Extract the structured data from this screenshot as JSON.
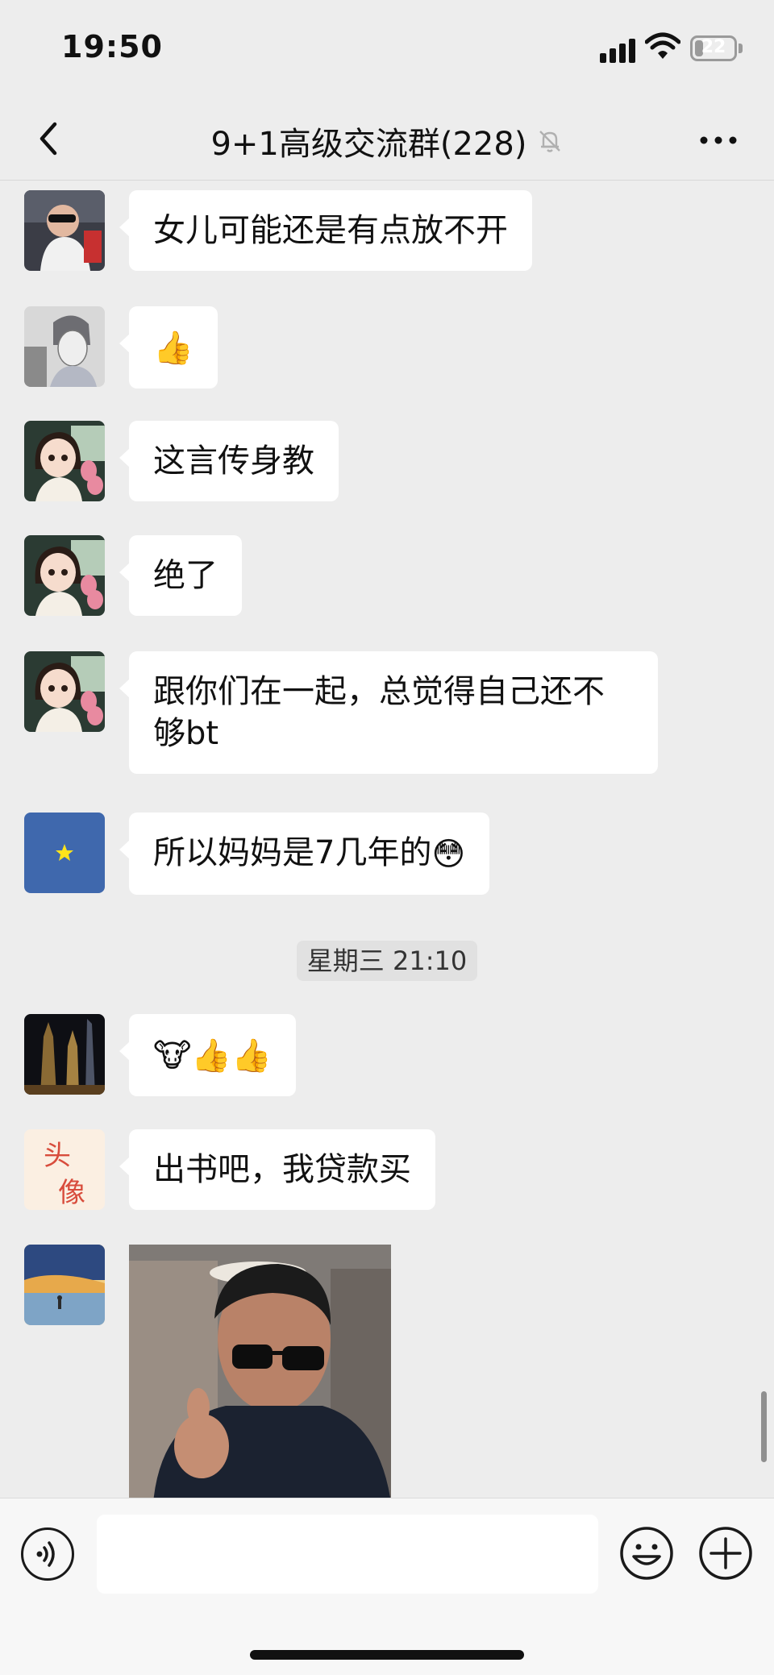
{
  "status_bar": {
    "time": "19:50",
    "battery": "22",
    "battery_level": 0.22
  },
  "header": {
    "title": "9+1高级交流群(228)",
    "back_icon": "chevron-left-icon",
    "mute_icon": "bell-slash-icon",
    "more_icon": "ellipsis-icon"
  },
  "messages": [
    {
      "type": "text",
      "avatar": "baby-photo",
      "text": "女儿可能还是有点放不开"
    },
    {
      "type": "emoji",
      "avatar": "anime-boy",
      "emoji": "👍"
    },
    {
      "type": "text",
      "avatar": "cartoon-girl",
      "text": "这言传身教"
    },
    {
      "type": "text",
      "avatar": "cartoon-girl",
      "text": "绝了"
    },
    {
      "type": "text",
      "avatar": "cartoon-girl",
      "text_line1": "跟你们在一起，总觉得自己还不",
      "text_line2": "够bt"
    },
    {
      "type": "text",
      "avatar": "blue-star",
      "text": "所以妈妈是7几年的",
      "emoji": "😳"
    },
    {
      "type": "time",
      "text": "星期三 21:10"
    },
    {
      "type": "emoji",
      "avatar": "city-night",
      "emoji": "🐮👍👍"
    },
    {
      "type": "text",
      "avatar": "calligraphy",
      "text": "出书吧，我贷款买",
      "avatar_text": "头像"
    },
    {
      "type": "sticker",
      "avatar": "painting",
      "sticker": "man-sunglasses-thumbs-up"
    }
  ],
  "input_bar": {
    "placeholder": "",
    "voice_icon": "voice-icon",
    "emoji_icon": "smiley-icon",
    "plus_icon": "plus-icon"
  }
}
